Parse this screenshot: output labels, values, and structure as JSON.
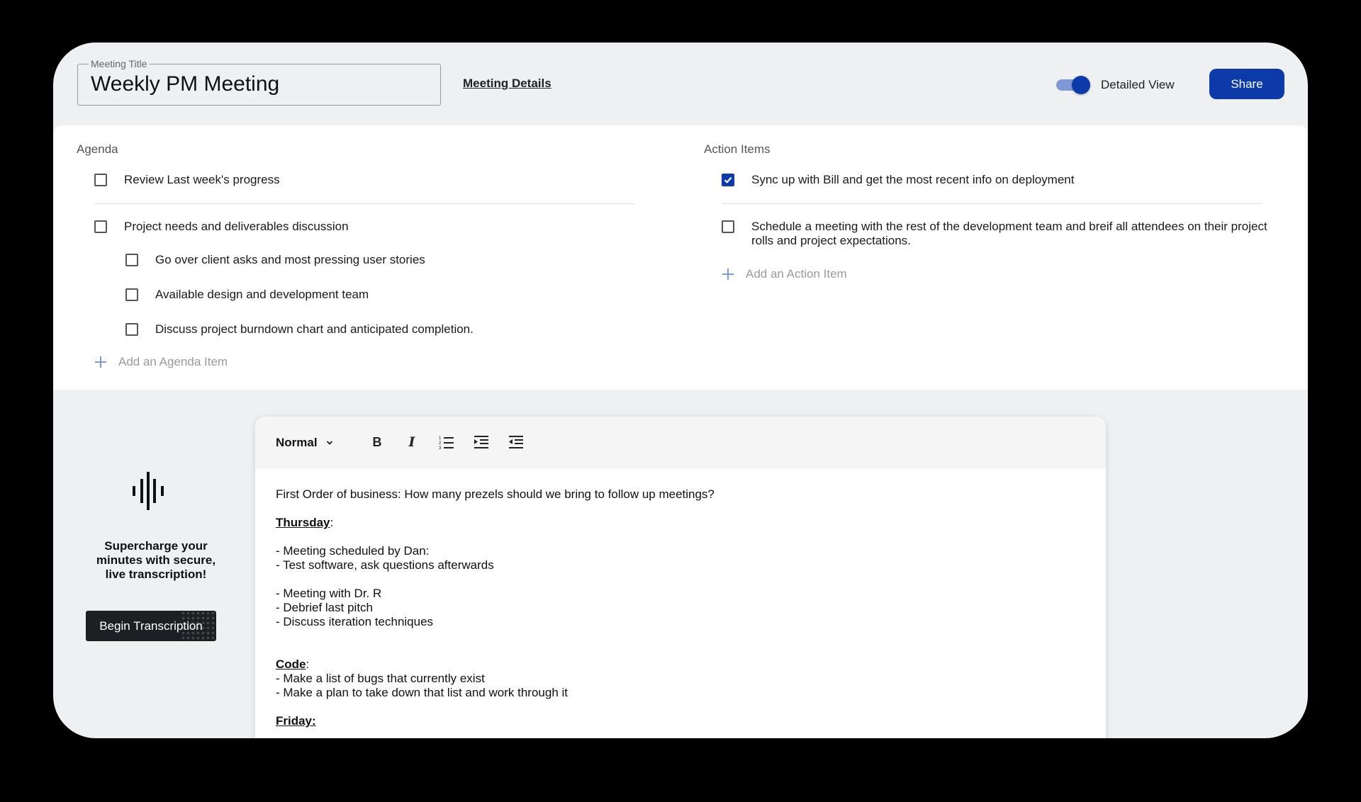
{
  "header": {
    "title_legend": "Meeting Title",
    "title_value": "Weekly PM Meeting",
    "details_link": "Meeting Details",
    "toggle_label": "Detailed View",
    "toggle_on": true,
    "share_label": "Share"
  },
  "agenda": {
    "label": "Agenda",
    "items": [
      {
        "text": "Review Last week's progress",
        "checked": false
      },
      {
        "text": "Project needs and deliverables discussion",
        "checked": false
      },
      {
        "text": "Go over client asks and most pressing user stories",
        "checked": false
      },
      {
        "text": "Available design and development team",
        "checked": false
      },
      {
        "text": "Discuss project burndown chart and anticipated completion.",
        "checked": false
      }
    ],
    "add_label": "Add an Agenda Item"
  },
  "actions": {
    "label": "Action Items",
    "items": [
      {
        "text": "Sync up with Bill and get the most recent info on deployment",
        "checked": true
      },
      {
        "text": "Schedule a meeting with the rest of the development team and breif all attendees on their project rolls and project expectations.",
        "checked": false
      }
    ],
    "add_label": "Add an Action Item"
  },
  "transcription": {
    "promo": "Supercharge your minutes with secure, live transcription!",
    "button_label": "Begin Transcription"
  },
  "editor": {
    "format": "Normal",
    "toolbar_icons": [
      "bold-icon",
      "italic-icon",
      "ordered-list-icon",
      "indent-icon",
      "outdent-icon"
    ],
    "lines": {
      "l1": "First Order of business: How many prezels should we bring to follow up meetings?",
      "thursday": "Thursday",
      "colon": ":",
      "l2": "- Meeting scheduled by Dan:",
      "l3": "- Test software, ask questions afterwards",
      "l4": "- Meeting with Dr. R",
      "l5": "- Debrief last pitch",
      "l6": "- Discuss iteration techniques",
      "code": "Code",
      "l7": "- Make a list of bugs that currently exist",
      "l8": "- Make a plan to take down that list and work through it",
      "friday": "Friday:"
    }
  },
  "colors": {
    "accent": "#0d3aa9",
    "accent_light": "#7f98d6",
    "background": "#eef0f2"
  }
}
